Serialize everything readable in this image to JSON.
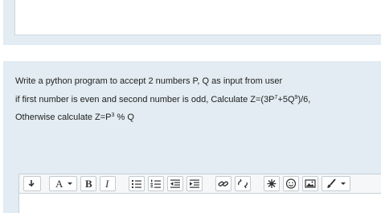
{
  "question": {
    "line1": "Write a python program to accept 2 numbers P, Q as input from user",
    "line2_pre": "if first number is even and second number is odd, Calculate Z=(3P",
    "line2_exp1": "7",
    "line2_mid": "+5Q",
    "line2_exp2": "9",
    "line2_post": ")/6,",
    "line3_pre": "Otherwise calculate Z=P",
    "line3_exp": "3",
    "line3_post": " % Q"
  },
  "toolbar": {
    "font_label": "A",
    "bold_label": "B",
    "italic_label": "I",
    "icons": [
      "collapse-icon",
      "font-size-icon",
      "bold-icon",
      "italic-icon",
      "unordered-list-icon",
      "ordered-list-icon",
      "outdent-icon",
      "indent-icon",
      "link-icon",
      "unlink-icon",
      "special-character-icon",
      "emoji-icon",
      "image-icon",
      "brush-icon"
    ]
  },
  "colors": {
    "panel_bg": "#e2ecf2",
    "toolbar_bg": "#f5f7f8",
    "text": "#222222"
  }
}
